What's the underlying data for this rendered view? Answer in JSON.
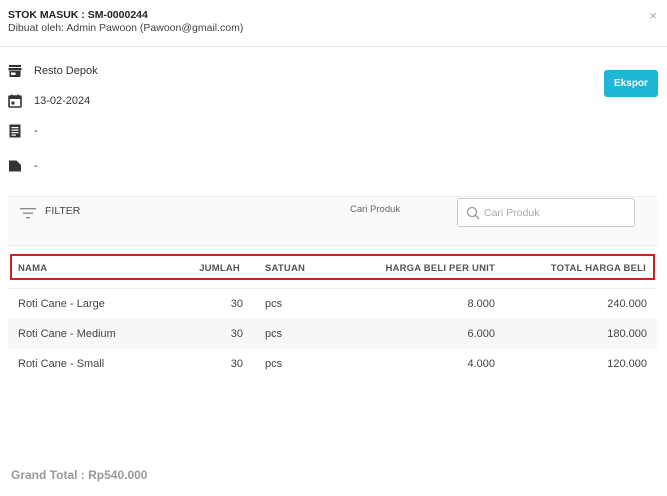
{
  "header": {
    "title": "STOK MASUK : SM-0000244",
    "subtitle": "Dibuat oleh: Admin Pawoon (Pawoon@gmail.com)",
    "close_glyph": "×"
  },
  "info": {
    "outlet": "Resto Depok",
    "date": "13-02-2024",
    "note": "-",
    "supplier": "-"
  },
  "icons": {
    "outlet": "store-icon",
    "date": "calendar-icon",
    "note": "document-icon",
    "supplier": "label-icon",
    "filter": "filter-icon",
    "search": "search-icon",
    "close": "close-icon"
  },
  "actions": {
    "export_label": "Ekspor"
  },
  "filter": {
    "label": "FILTER",
    "search_label": "Cari Produk",
    "search_placeholder": "Cari Produk",
    "search_value": ""
  },
  "table": {
    "columns": [
      "NAMA",
      "JUMLAH",
      "SATUAN",
      "HARGA BELI PER UNIT",
      "TOTAL HARGA BELI"
    ],
    "rows": [
      [
        "Roti Cane - Large",
        "30",
        "pcs",
        "8.000",
        "240.000"
      ],
      [
        "Roti Cane - Medium",
        "30",
        "pcs",
        "6.000",
        "180.000"
      ],
      [
        "Roti Cane - Small",
        "30",
        "pcs",
        "4.000",
        "120.000"
      ]
    ]
  },
  "footer": {
    "grand_total": "Grand Total : Rp540.000"
  },
  "colors": {
    "accent": "#1fb6d5",
    "highlight_border": "#cc2027",
    "icon_dark": "#333333"
  }
}
